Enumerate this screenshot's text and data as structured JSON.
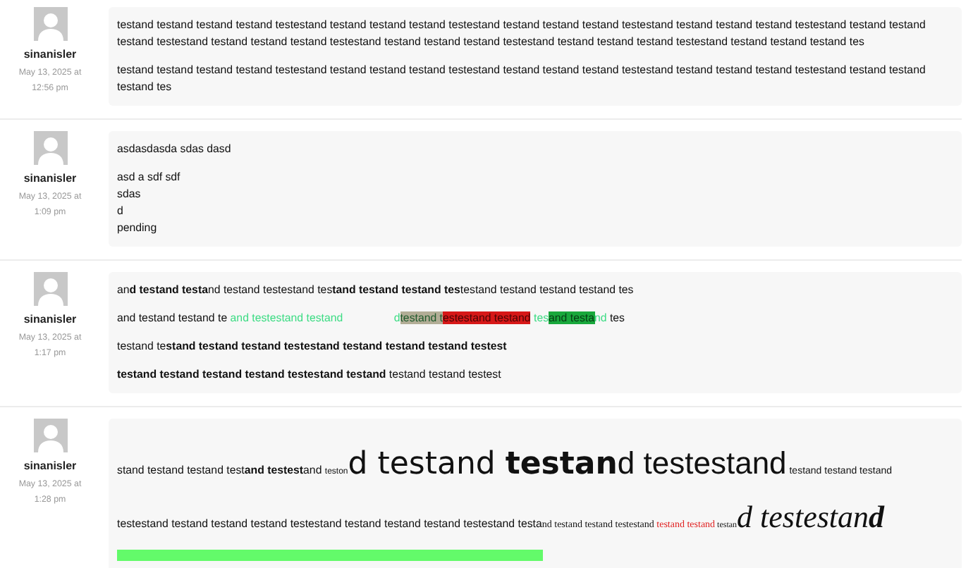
{
  "comments": [
    {
      "author": "sinanisler",
      "date": "May 13, 2025 at 12:56 pm",
      "paragraphs": [
        {
          "runs": [
            {
              "kind": "normal",
              "text": "testand testand testand testand testestand testand testand testand testestand testand testand testand testestand testand testand testand testestand testand testand testand testestand testand testand testand testestand testand testand testand testestand testand testand testand testestand testand testand testand tes"
            }
          ]
        },
        {
          "runs": [
            {
              "kind": "normal",
              "text": "testand testand testand testand testestand testand testand testand testestand testand testand testand testestand testand testand testand testestand testand testand testand tes"
            }
          ]
        }
      ]
    },
    {
      "author": "sinanisler",
      "date": "May 13, 2025 at 1:09 pm",
      "paragraphs": [
        {
          "runs": [
            {
              "kind": "normal",
              "text": "asdasdasda sdas dasd"
            }
          ]
        },
        {
          "lines": [
            "asd a sdf sdf",
            "sdas",
            "d",
            "pending"
          ]
        }
      ]
    },
    {
      "author": "sinanisler",
      "date": "May 13, 2025 at 1:17 pm",
      "paragraphs": [
        {
          "runs": [
            {
              "kind": "normal",
              "text": "an"
            },
            {
              "kind": "bold",
              "text": "d testand testa"
            },
            {
              "kind": "normal",
              "text": "nd testand testestand tes"
            },
            {
              "kind": "bold",
              "text": "tand testand testand tes"
            },
            {
              "kind": "normal",
              "text": "testand testand testand testand tes"
            }
          ]
        },
        {
          "runs": [
            {
              "kind": "normal",
              "text": "and testand testand te "
            },
            {
              "kind": "green",
              "text": " and testestand testand "
            },
            {
              "kind": "gap",
              "text": "d"
            },
            {
              "kind": "mark-tan",
              "text": "testand t"
            },
            {
              "kind": "mark-red",
              "text": "estestand testand"
            },
            {
              "kind": "green",
              "text": " tes"
            },
            {
              "kind": "mark-green",
              "text": "and testa"
            },
            {
              "kind": "green",
              "text": "nd"
            },
            {
              "kind": "normal",
              "text": " tes"
            }
          ]
        },
        {
          "runs": [
            {
              "kind": "normal",
              "text": "testand te"
            },
            {
              "kind": "bold",
              "text": "stand testand testand testestand testand testand testand testest"
            }
          ]
        },
        {
          "runs": [
            {
              "kind": "bold",
              "text": "testand testand testand testand testestand testand"
            },
            {
              "kind": "normal",
              "text": " testand testand testest"
            }
          ]
        }
      ]
    },
    {
      "author": "sinanisler",
      "date": "May 13, 2025 at 1:28 pm",
      "paragraphs": [
        {
          "runs": [
            {
              "kind": "normal",
              "text": "stand testand testand test"
            },
            {
              "kind": "bold",
              "text": "and testest"
            },
            {
              "kind": "normal",
              "text": "and "
            },
            {
              "kind": "tiny",
              "text": "teston"
            },
            {
              "kind": "huge",
              "text": "d testand "
            },
            {
              "kind": "huge-bold",
              "text": "testan"
            },
            {
              "kind": "large",
              "text": "d testestand"
            },
            {
              "kind": "small",
              "text": " testand testand testand"
            }
          ]
        },
        {
          "runs": [
            {
              "kind": "normal",
              "text": "testestand testand testand testand testestand testand testand testand testestand testa"
            },
            {
              "kind": "serif",
              "text": "nd testand testand testestand "
            },
            {
              "kind": "serif-red",
              "text": "testand testand"
            },
            {
              "kind": "serif-tiny",
              "text": " testan"
            },
            {
              "kind": "serif-italic",
              "text": "d testestan"
            },
            {
              "kind": "serif-bold-italic",
              "text": "d"
            }
          ]
        },
        {
          "kind": "bar",
          "level": 0.51
        }
      ]
    }
  ]
}
